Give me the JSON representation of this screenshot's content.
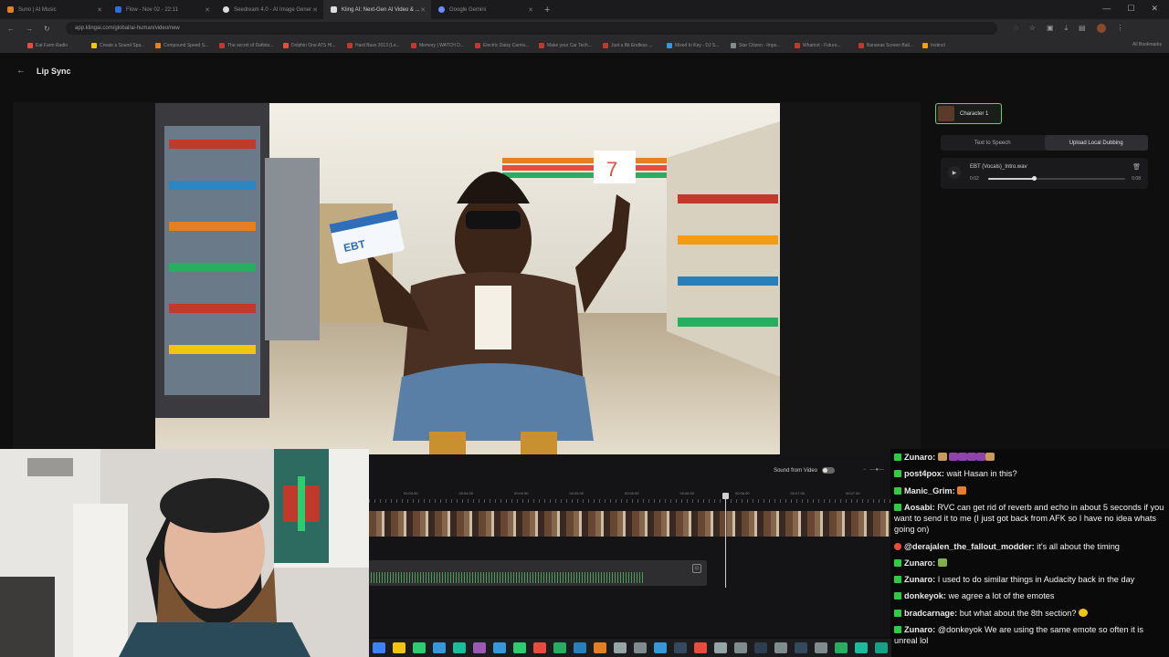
{
  "browser": {
    "tabs": [
      {
        "label": "Suno | AI Music",
        "color": "#e67e22"
      },
      {
        "label": "Flow - Nov 02 - 22:11",
        "color": "#2c6ee0"
      },
      {
        "label": "Seedream 4.0 - AI Image Gener",
        "color": "#dddddd"
      },
      {
        "label": "Kling AI: Next-Gen AI Video & ...",
        "color": "#dddddd"
      },
      {
        "label": "Google Gemini",
        "color": "#6a8cff"
      }
    ],
    "url": "app.klingai.com/global/ai-human/video/new",
    "bookmarks": [
      "Eat Farm Radio",
      "Create a Sound Spa...",
      "Compound Speed S...",
      "The secret of Daftsto...",
      "Dolphin One ATS Hi...",
      "Hard Bass 2013 (Lo...",
      "Memory | WATCH D...",
      "Electric Daisy Carniv...",
      "Make your Car Tech...",
      "Just a Bit Endless ...",
      "Mixed In Key - DJ S...",
      "Star Citizen - Impo...",
      "Whatnot - Future...",
      "Bananas Screen Bali...",
      "Instinct"
    ],
    "all_bookmarks": "All Bookmarks"
  },
  "page": {
    "title": "Lip Sync"
  },
  "character": {
    "label": "Character 1"
  },
  "mode_tabs": [
    "Text to Speech",
    "Upload Local Dubbing"
  ],
  "audio": {
    "filename": "EBT (Vocals)_Intro.wav",
    "current": "0:02",
    "duration": "0:08",
    "progress": 0.33
  },
  "video": {
    "card_text": "EBT"
  },
  "timeline": {
    "sound_from_video": "Sound from Video",
    "ticks": [
      "00:03.50",
      "00:04.00",
      "00:04.50",
      "00:05.00",
      "00:05.50",
      "00:06.00",
      "00:06.50",
      "00:07.00",
      "00:07.50"
    ]
  },
  "chat": [
    {
      "user": "Zunaro:",
      "text": "",
      "badge": "green",
      "emotes": 6
    },
    {
      "user": "post4pox:",
      "text": "wait Hasan in this?",
      "badge": "green"
    },
    {
      "user": "Manic_Grim:",
      "text": "",
      "badge": "green",
      "emotes": 1
    },
    {
      "user": "Aosabi:",
      "text": "RVC can get rid of reverb and echo in about 5 seconds if you want to send it to me (I just got back from AFK so I have no idea whats going on)",
      "badge": "green"
    },
    {
      "user": "@derajalen_the_fallout_modder:",
      "text": "it's all about the timing",
      "badge": "yt"
    },
    {
      "user": "Zunaro:",
      "text": "",
      "badge": "green",
      "emotes": 1
    },
    {
      "user": "Zunaro:",
      "text": "I used to do similar things in Audacity back in the day",
      "badge": "green"
    },
    {
      "user": "donkeyok:",
      "text": "we agree a lot of the emotes",
      "badge": "green"
    },
    {
      "user": "bradcarnage:",
      "text": "but what about the 8th section?",
      "badge": "green",
      "emotes": 1
    },
    {
      "user": "Zunaro:",
      "text": "@donkeyok We are using the same emote so often it is unreal lol",
      "badge": "green"
    }
  ]
}
